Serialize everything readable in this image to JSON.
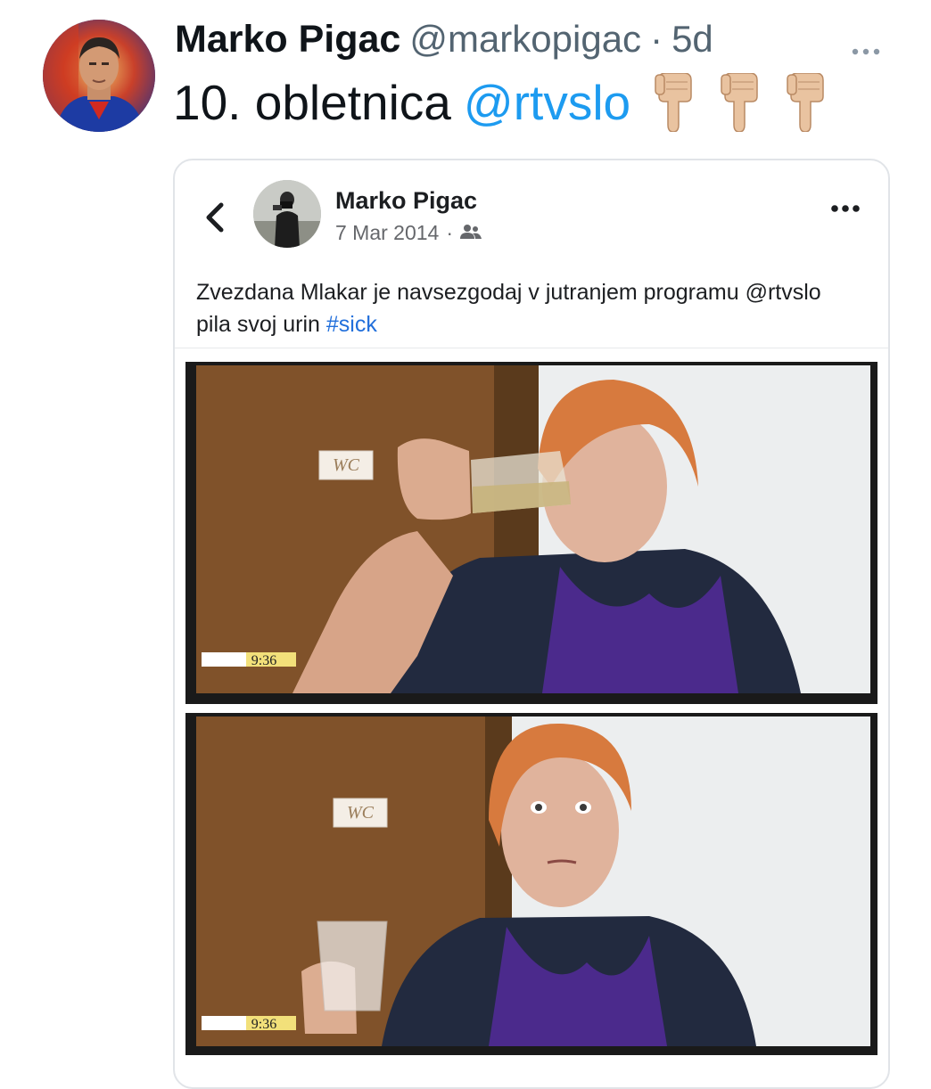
{
  "tweet": {
    "author_name": "Marko Pigac",
    "handle": "@markopigac",
    "separator": "·",
    "time": "5d",
    "more_icon": "more-dots-icon",
    "text_prefix": "10. obletnica",
    "mention": "@rtvslo",
    "emoji": [
      "pointing-down-hand",
      "pointing-down-hand",
      "pointing-down-hand"
    ]
  },
  "embedded_post": {
    "back_icon": "chevron-left-icon",
    "author_name": "Marko Pigac",
    "date": "7 Mar 2014",
    "meta_separator": "·",
    "audience_icon": "friends-icon",
    "more_icon": "horizontal-dots-icon",
    "text": "Zvezdana Mlakar je navsezgodaj v jutranjem programu @rtvslo pila svoj urin",
    "hashtag": "#sick",
    "photos": [
      {
        "sign_text": "WC",
        "timestamp": "9:36"
      },
      {
        "sign_text": "WC",
        "timestamp": "9:36"
      }
    ]
  },
  "colors": {
    "link_blue": "#1d9bf0",
    "fb_link_blue": "#216fdb",
    "scarf_purple": "#4b2a8c",
    "door_wood": "#8a5a2e"
  }
}
